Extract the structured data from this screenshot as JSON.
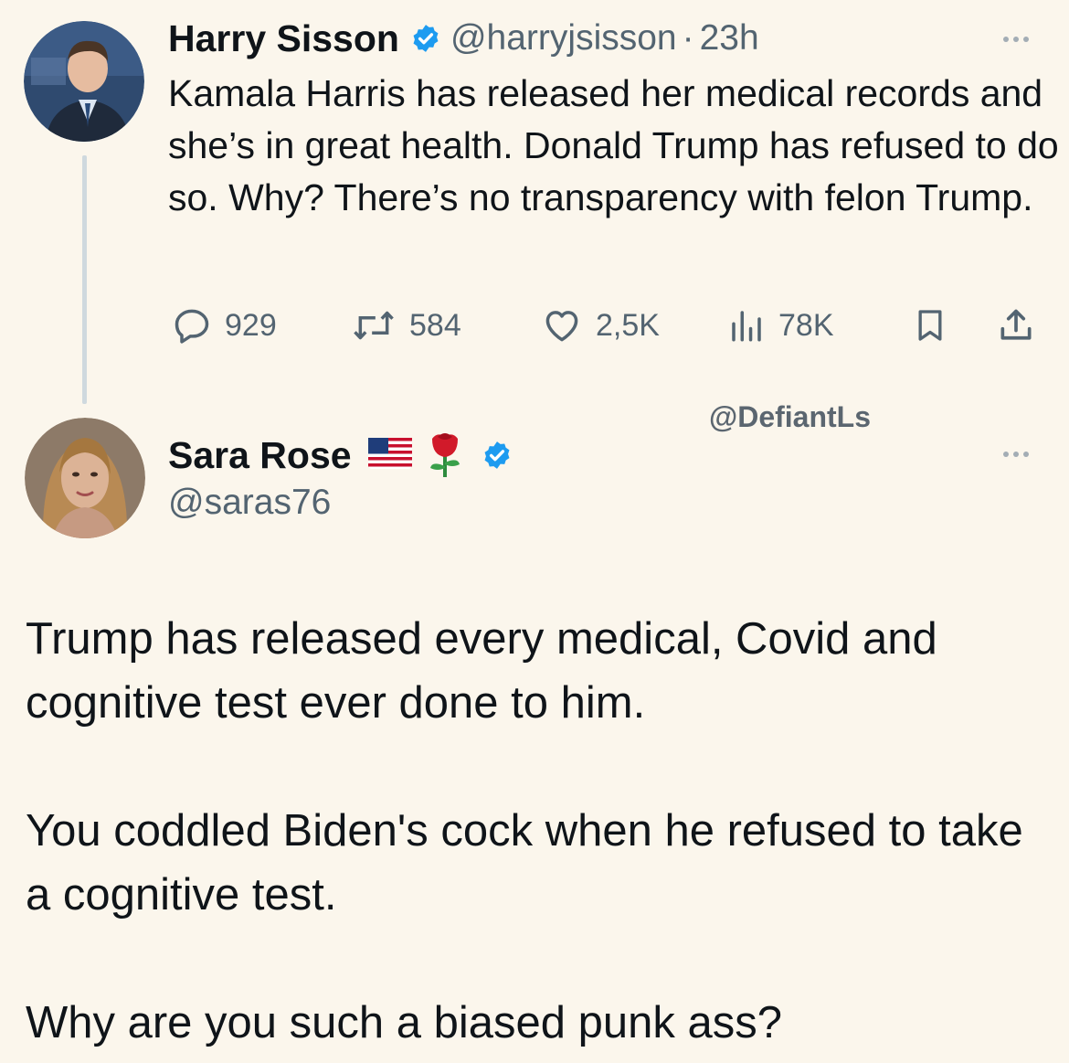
{
  "tweet1": {
    "name": "Harry Sisson",
    "handle": "@harryjsisson",
    "separator": "·",
    "time": "23h",
    "text": "Kamala Harris has released her medical records and she’s in great health. Donald Trump has refused to do so. Why? There’s no transparency with felon Trump.",
    "actions": {
      "replies": "929",
      "reposts": "584",
      "likes": "2,5K",
      "views": "78K"
    }
  },
  "watermark": "@DefiantLs",
  "tweet2": {
    "name": "Sara Rose",
    "name_emojis": [
      "us-flag",
      "rose"
    ],
    "handle": "@saras76",
    "paragraphs": [
      "Trump has released every medical, Covid and cognitive test ever done to him.",
      "You coddled Biden's cock when he refused to take a cognitive test.",
      "Why are you such a biased punk ass?"
    ]
  },
  "colors": {
    "background": "#fbf6ec",
    "verified_blue": "#1d9bf0",
    "muted_text": "#536471",
    "thread_line": "#cfd9de"
  },
  "icons": [
    "verified-badge-icon",
    "reply-icon",
    "repost-icon",
    "like-icon",
    "views-icon",
    "bookmark-icon",
    "share-icon",
    "more-options-icon"
  ]
}
